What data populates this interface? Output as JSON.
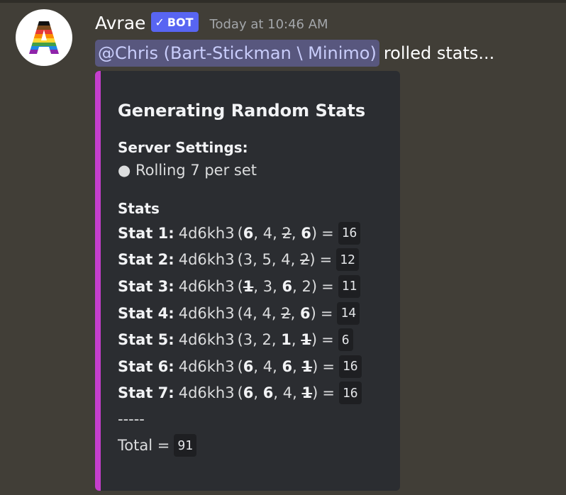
{
  "message": {
    "author": "Avrae",
    "bot_badge": "BOT",
    "timestamp": "Today at 10:46 AM",
    "mention": "@Chris (Bart-Stickman \\ Minimo)",
    "content_rest": "rolled stats...",
    "avatar_letter": "A",
    "accent_color": "#c43ecc",
    "badge_color": "#5865f2"
  },
  "embed": {
    "title": "Generating Random Stats",
    "settings_name": "Server Settings:",
    "settings_line": "● Rolling 7 per set",
    "stats_name": "Stats",
    "stats": [
      {
        "label": "Stat 1:",
        "expr": "4d6kh3",
        "rolls": [
          {
            "v": "6",
            "s": "keep"
          },
          {
            "v": "4",
            "s": "normal"
          },
          {
            "v": "2",
            "s": "drop"
          },
          {
            "v": "6",
            "s": "keep"
          }
        ],
        "total": "16"
      },
      {
        "label": "Stat 2:",
        "expr": "4d6kh3",
        "rolls": [
          {
            "v": "3",
            "s": "normal"
          },
          {
            "v": "5",
            "s": "normal"
          },
          {
            "v": "4",
            "s": "normal"
          },
          {
            "v": "2",
            "s": "drop"
          }
        ],
        "total": "12"
      },
      {
        "label": "Stat 3:",
        "expr": "4d6kh3",
        "rolls": [
          {
            "v": "1",
            "s": "dropkeep"
          },
          {
            "v": "3",
            "s": "normal"
          },
          {
            "v": "6",
            "s": "keep"
          },
          {
            "v": "2",
            "s": "normal"
          }
        ],
        "total": "11"
      },
      {
        "label": "Stat 4:",
        "expr": "4d6kh3",
        "rolls": [
          {
            "v": "4",
            "s": "normal"
          },
          {
            "v": "4",
            "s": "normal"
          },
          {
            "v": "2",
            "s": "drop"
          },
          {
            "v": "6",
            "s": "keep"
          }
        ],
        "total": "14"
      },
      {
        "label": "Stat 5:",
        "expr": "4d6kh3",
        "rolls": [
          {
            "v": "3",
            "s": "normal"
          },
          {
            "v": "2",
            "s": "normal"
          },
          {
            "v": "1",
            "s": "keep"
          },
          {
            "v": "1",
            "s": "dropkeep"
          }
        ],
        "total": "6"
      },
      {
        "label": "Stat 6:",
        "expr": "4d6kh3",
        "rolls": [
          {
            "v": "6",
            "s": "keep"
          },
          {
            "v": "4",
            "s": "normal"
          },
          {
            "v": "6",
            "s": "keep"
          },
          {
            "v": "1",
            "s": "dropkeep"
          }
        ],
        "total": "16"
      },
      {
        "label": "Stat 7:",
        "expr": "4d6kh3",
        "rolls": [
          {
            "v": "6",
            "s": "keep"
          },
          {
            "v": "6",
            "s": "keep"
          },
          {
            "v": "4",
            "s": "normal"
          },
          {
            "v": "1",
            "s": "dropkeep"
          }
        ],
        "total": "16"
      }
    ],
    "dashes": "-----",
    "total_label": "Total =",
    "total_value": "91"
  }
}
